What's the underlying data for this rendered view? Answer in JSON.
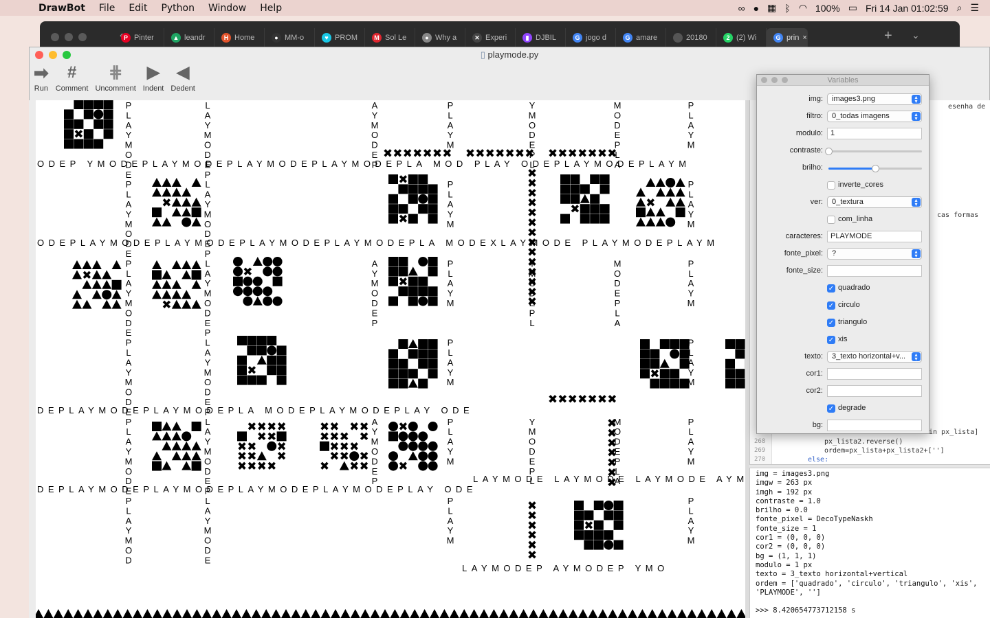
{
  "menubar": {
    "app": "DrawBot",
    "items": [
      "File",
      "Edit",
      "Python",
      "Window",
      "Help"
    ],
    "battery": "100%",
    "clock": "Fri 14 Jan  01:02:59"
  },
  "browser": {
    "tabs": [
      {
        "label": "Pinter",
        "color": "#e60023",
        "glyph": "P"
      },
      {
        "label": "leandr",
        "color": "#1fa463",
        "glyph": "▲"
      },
      {
        "label": "Home",
        "color": "#e2532b",
        "glyph": "H"
      },
      {
        "label": "MM-o",
        "color": "#333333",
        "glyph": "●"
      },
      {
        "label": "PROM",
        "color": "#19c8e6",
        "glyph": "♥"
      },
      {
        "label": "Sol Le",
        "color": "#e0262f",
        "glyph": "M"
      },
      {
        "label": "Why a",
        "color": "#888888",
        "glyph": "●"
      },
      {
        "label": "Experi",
        "color": "#444444",
        "glyph": "✕"
      },
      {
        "label": "DJBIL",
        "color": "#9146ff",
        "glyph": "▮"
      },
      {
        "label": "jogo d",
        "color": "#4285f4",
        "glyph": "G"
      },
      {
        "label": "amare",
        "color": "#4285f4",
        "glyph": "G"
      },
      {
        "label": "20180",
        "color": "#555555",
        "glyph": ""
      },
      {
        "label": "(2) Wi",
        "color": "#25d366",
        "glyph": "2"
      },
      {
        "label": "prin",
        "color": "#4285f4",
        "glyph": "G"
      }
    ]
  },
  "window": {
    "title": "playmode.py",
    "toolbar": [
      {
        "label": "Run",
        "icon": "▶"
      },
      {
        "label": "Comment",
        "icon": "#"
      },
      {
        "label": "Uncomment",
        "icon": "#"
      },
      {
        "label": "Indent",
        "icon": "▶"
      },
      {
        "label": "Dedent",
        "icon": "◀"
      }
    ]
  },
  "variables": {
    "title": "Variables",
    "img": "images3.png",
    "filtro": "0_todas imagens",
    "modulo": "1",
    "contraste_value": 0.0,
    "brilho_value": 0.5,
    "inverte_cores": false,
    "ver": "0_textura",
    "com_linha": false,
    "caracteres": "PLAYMODE",
    "fonte_pixel": "?",
    "fonte_size": "",
    "quadrado": true,
    "circulo": true,
    "triangulo": true,
    "xis": true,
    "texto": "3_texto horizontal+v...",
    "cor1": "",
    "cor2": "",
    "degrade": true,
    "bg": "",
    "labels": {
      "img": "img:",
      "filtro": "filtro:",
      "modulo": "modulo:",
      "contraste": "contraste:",
      "brilho": "brilho:",
      "inverte_cores": "inverte_cores",
      "ver": "ver:",
      "com_linha": "com_linha",
      "caracteres": "caracteres:",
      "fonte_pixel": "fonte_pixel:",
      "fonte_size": "fonte_size:",
      "quadrado": "quadrado",
      "circulo": "circulo",
      "triangulo": "triangulo",
      "xis": "xis",
      "texto": "texto:",
      "cor1": "cor1:",
      "cor2": "cor2:",
      "degrade": "degrade",
      "bg": "bg:"
    }
  },
  "editor": {
    "snippets": [
      "esenha de",
      "cas formas",
      "in px_lista]",
      "px_lista2.reverse()",
      "ordem=px_lista+px_lista2+['']",
      "else:"
    ],
    "line_numbers": [
      "268",
      "269",
      "270"
    ]
  },
  "console": {
    "lines": [
      "img = images3.png",
      "imgw = 263 px",
      "imgh = 192 px",
      "contraste = 1.0",
      "brilho = 0.0",
      "fonte_pixel = DecoTypeNaskh",
      "fonte_size = 1",
      "cor1 = (0, 0, 0)",
      "cor2 = (0, 0, 0)",
      "bg = (1, 1, 1)",
      "modulo = 1 px",
      "texto = 3_texto horizontal+vertical",
      "ordem = ['quadrado', 'circulo', 'triangulo', 'xis',",
      "'PLAYMODE', '']",
      "",
      ">>> 8.420654773712158 s"
    ]
  },
  "canvas": {
    "rows": [
      "ODEP  YMODEPLAYMODEPLAYMODEPLAYMODEPLA MOD         PLAY ODEPLAYMODEPLAYM",
      "ODEPLAYMODEPLAYMODEPLAYMODEPLAYMODEPLA MODEXLAYMODE  PLAYMODEPLAYM",
      "DEPLAYMODEPLAYMODEPLA MODEPLAYMODEPLAY ODE",
      "DEPLAYMODEPLAYMODEPLAYMODEPLAYMODEPLAY ODE",
      "LAYMODE LAYMODE  LAYMODE  AYM",
      "LAYMODEP          AYMODEP  YMO"
    ]
  }
}
